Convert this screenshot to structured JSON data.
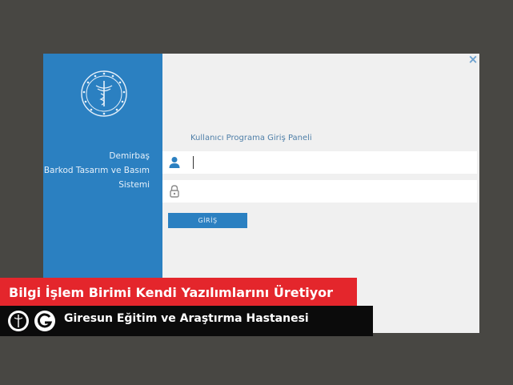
{
  "window": {
    "close_glyph": "×",
    "sidebar": {
      "logo_icon": "ministry-of-health-emblem-icon",
      "system_name_lines": [
        "Demirbaş",
        "Barkod Tasarım ve Basım",
        "Sistemi"
      ]
    },
    "panel_title": "Kullanıcı Programa Giriş Paneli",
    "username_field": {
      "icon": "user-icon",
      "value": "",
      "placeholder": ""
    },
    "password_field": {
      "icon": "lock-icon",
      "value": "",
      "placeholder": ""
    },
    "login_button_label": "GİRİŞ"
  },
  "overlay": {
    "headline": "Bilgi İşlem Birimi Kendi Yazılımlarını Üretiyor",
    "hospital_name": "Giresun Eğitim ve Araştırma Hastanesi",
    "emblems": [
      "ministry-emblem-icon",
      "hospital-logo-icon"
    ]
  },
  "colors": {
    "background": "#484743",
    "sidebar": "#2b80c1",
    "button": "#2b80c1",
    "banner_red": "#e4262c",
    "banner_black": "#0b0b0b"
  }
}
